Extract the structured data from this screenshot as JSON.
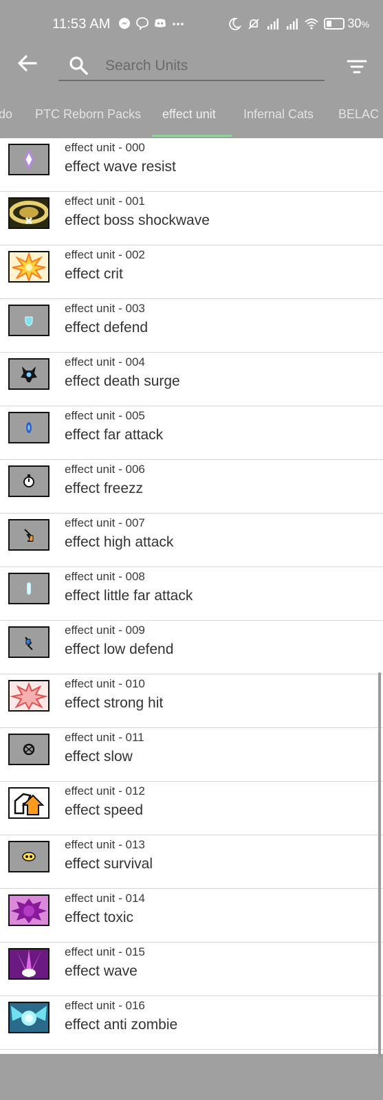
{
  "status_bar": {
    "time": "11:53 AM",
    "battery_percent": "30",
    "battery_unit": "%",
    "battery_level": 0.3,
    "left_icons": [
      "messenger-icon",
      "viber-icon",
      "discord-icon",
      "more-dots-icon"
    ],
    "right_icons": [
      "moon-icon",
      "bell-off-icon",
      "signal-icon",
      "signal-icon",
      "wifi-icon",
      "battery-icon"
    ]
  },
  "app_bar": {
    "back_icon": "arrow-left-icon",
    "search_icon": "search-icon",
    "search_placeholder": "Search Units",
    "search_value": "",
    "filter_icon": "filter-icon"
  },
  "tabs": [
    {
      "label": "do",
      "active": false
    },
    {
      "label": "PTC Reborn Packs",
      "active": false
    },
    {
      "label": "effect unit",
      "active": true
    },
    {
      "label": "Infernal Cats",
      "active": false
    },
    {
      "label": "BELAC R",
      "active": false
    }
  ],
  "colors": {
    "background": "#a0a0a0",
    "list_background": "#ffffff",
    "tab_indicator": "#8fd29c",
    "text_primary": "#333333"
  },
  "units": [
    {
      "code": "effect unit - 000",
      "name": "effect wave resist",
      "icon": "wave-resist-icon"
    },
    {
      "code": "effect unit - 001",
      "name": "effect boss shockwave",
      "icon": "boss-shockwave-icon"
    },
    {
      "code": "effect unit - 002",
      "name": "effect crit",
      "icon": "crit-icon"
    },
    {
      "code": "effect unit - 003",
      "name": "effect defend",
      "icon": "defend-icon"
    },
    {
      "code": "effect unit - 004",
      "name": "effect death surge",
      "icon": "death-surge-icon"
    },
    {
      "code": "effect unit - 005",
      "name": "effect far attack",
      "icon": "far-attack-icon"
    },
    {
      "code": "effect unit - 006",
      "name": "effect freezz",
      "icon": "freeze-icon"
    },
    {
      "code": "effect unit - 007",
      "name": "effect high attack",
      "icon": "high-attack-icon"
    },
    {
      "code": "effect unit - 008",
      "name": "effect little far attack",
      "icon": "little-far-attack-icon"
    },
    {
      "code": "effect unit - 009",
      "name": "effect low defend",
      "icon": "low-defend-icon"
    },
    {
      "code": "effect unit - 010",
      "name": "effect strong hit",
      "icon": "strong-hit-icon"
    },
    {
      "code": "effect unit - 011",
      "name": "effect slow",
      "icon": "slow-icon"
    },
    {
      "code": "effect unit - 012",
      "name": "effect speed",
      "icon": "speed-icon"
    },
    {
      "code": "effect unit - 013",
      "name": "effect survival",
      "icon": "survival-icon"
    },
    {
      "code": "effect unit - 014",
      "name": "effect toxic",
      "icon": "toxic-icon"
    },
    {
      "code": "effect unit - 015",
      "name": "effect wave",
      "icon": "wave-icon"
    },
    {
      "code": "effect unit - 016",
      "name": "effect anti zombie",
      "icon": "anti-zombie-icon"
    }
  ]
}
